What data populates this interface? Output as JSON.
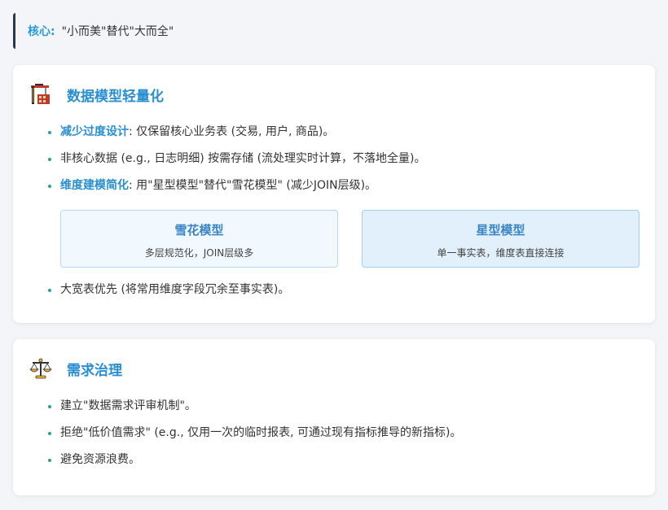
{
  "core": {
    "label": "核心:",
    "text": "\"小而美\"替代\"大而全\""
  },
  "section1": {
    "title": "数据模型轻量化",
    "bullet1": {
      "highlight": "减少过度设计",
      "text": ": 仅保留核心业务表 (交易, 用户, 商品)。"
    },
    "bullet2": {
      "text": "非核心数据 (e.g., 日志明细) 按需存储 (流处理实时计算，不落地全量)。"
    },
    "bullet3": {
      "highlight": "维度建模简化",
      "text": ": 用\"星型模型\"替代\"雪花模型\" (减少JOIN层级)。"
    },
    "snowflake": {
      "title": "雪花模型",
      "desc": "多层规范化，JOIN层级多"
    },
    "star": {
      "title": "星型模型",
      "desc": "单一事实表，维度表直接连接"
    },
    "bullet4": {
      "text": "大宽表优先 (将常用维度字段冗余至事实表)。"
    }
  },
  "section2": {
    "title": "需求治理",
    "bullets": [
      "建立\"数据需求评审机制\"。",
      "拒绝\"低价值需求\" (e.g., 仅用一次的临时报表, 可通过现有指标推导的新指标)。",
      "避免资源浪费。"
    ]
  }
}
